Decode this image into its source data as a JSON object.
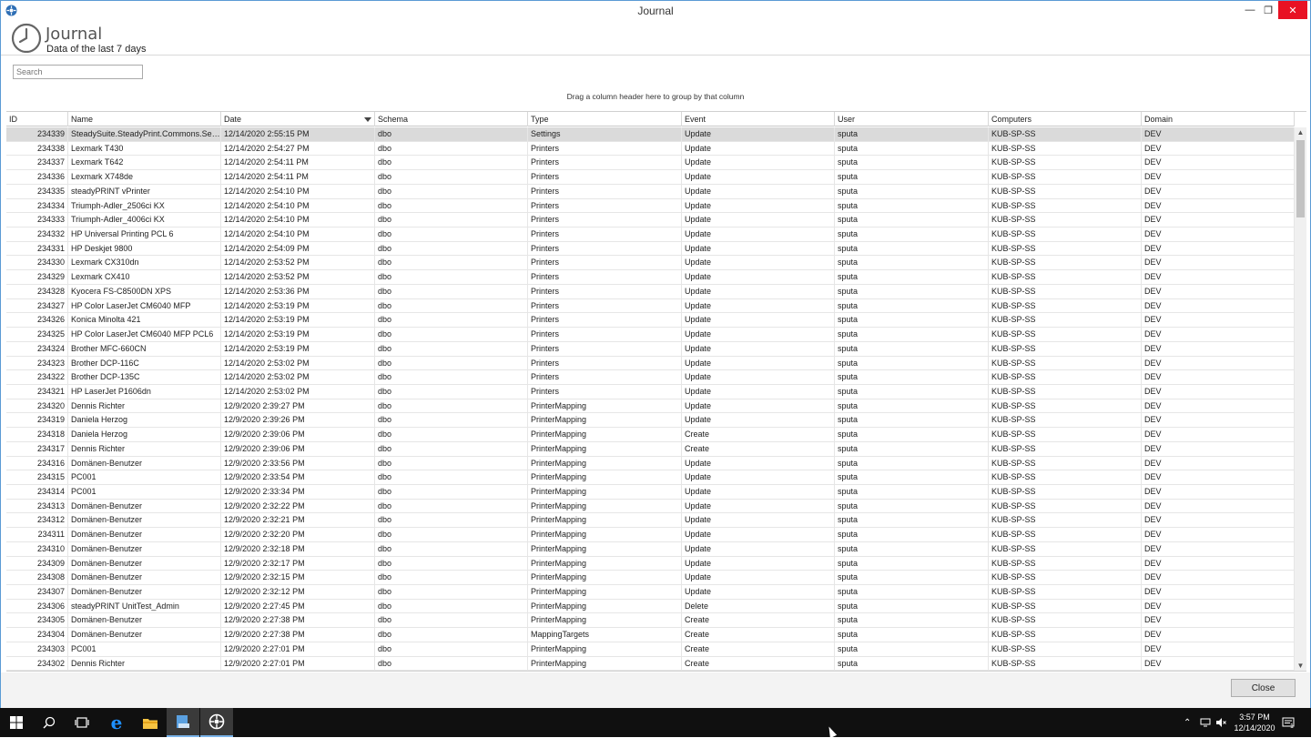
{
  "window": {
    "title": "Journal"
  },
  "header": {
    "title": "Journal",
    "subtitle": "Data of the last 7 days"
  },
  "search": {
    "placeholder": "Search"
  },
  "group_hint": "Drag a column header here to group by that column",
  "columns": [
    "ID",
    "Name",
    "Date",
    "Schema",
    "Type",
    "Event",
    "User",
    "Computers",
    "Domain"
  ],
  "rows": [
    [
      "234339",
      "SteadySuite.SteadyPrint.Commons.Sett...",
      "12/14/2020 2:55:15 PM",
      "dbo",
      "Settings",
      "Update",
      "sputa",
      "KUB-SP-SS",
      "DEV"
    ],
    [
      "234338",
      "Lexmark T430",
      "12/14/2020 2:54:27 PM",
      "dbo",
      "Printers",
      "Update",
      "sputa",
      "KUB-SP-SS",
      "DEV"
    ],
    [
      "234337",
      "Lexmark T642",
      "12/14/2020 2:54:11 PM",
      "dbo",
      "Printers",
      "Update",
      "sputa",
      "KUB-SP-SS",
      "DEV"
    ],
    [
      "234336",
      "Lexmark X748de",
      "12/14/2020 2:54:11 PM",
      "dbo",
      "Printers",
      "Update",
      "sputa",
      "KUB-SP-SS",
      "DEV"
    ],
    [
      "234335",
      "steadyPRINT vPrinter",
      "12/14/2020 2:54:10 PM",
      "dbo",
      "Printers",
      "Update",
      "sputa",
      "KUB-SP-SS",
      "DEV"
    ],
    [
      "234334",
      "Triumph-Adler_2506ci KX",
      "12/14/2020 2:54:10 PM",
      "dbo",
      "Printers",
      "Update",
      "sputa",
      "KUB-SP-SS",
      "DEV"
    ],
    [
      "234333",
      "Triumph-Adler_4006ci KX",
      "12/14/2020 2:54:10 PM",
      "dbo",
      "Printers",
      "Update",
      "sputa",
      "KUB-SP-SS",
      "DEV"
    ],
    [
      "234332",
      "HP Universal Printing PCL 6",
      "12/14/2020 2:54:10 PM",
      "dbo",
      "Printers",
      "Update",
      "sputa",
      "KUB-SP-SS",
      "DEV"
    ],
    [
      "234331",
      "HP Deskjet 9800",
      "12/14/2020 2:54:09 PM",
      "dbo",
      "Printers",
      "Update",
      "sputa",
      "KUB-SP-SS",
      "DEV"
    ],
    [
      "234330",
      "Lexmark CX310dn",
      "12/14/2020 2:53:52 PM",
      "dbo",
      "Printers",
      "Update",
      "sputa",
      "KUB-SP-SS",
      "DEV"
    ],
    [
      "234329",
      "Lexmark CX410",
      "12/14/2020 2:53:52 PM",
      "dbo",
      "Printers",
      "Update",
      "sputa",
      "KUB-SP-SS",
      "DEV"
    ],
    [
      "234328",
      "Kyocera FS-C8500DN XPS",
      "12/14/2020 2:53:36 PM",
      "dbo",
      "Printers",
      "Update",
      "sputa",
      "KUB-SP-SS",
      "DEV"
    ],
    [
      "234327",
      "HP Color LaserJet CM6040 MFP",
      "12/14/2020 2:53:19 PM",
      "dbo",
      "Printers",
      "Update",
      "sputa",
      "KUB-SP-SS",
      "DEV"
    ],
    [
      "234326",
      "Konica Minolta 421",
      "12/14/2020 2:53:19 PM",
      "dbo",
      "Printers",
      "Update",
      "sputa",
      "KUB-SP-SS",
      "DEV"
    ],
    [
      "234325",
      "HP Color LaserJet CM6040 MFP PCL6",
      "12/14/2020 2:53:19 PM",
      "dbo",
      "Printers",
      "Update",
      "sputa",
      "KUB-SP-SS",
      "DEV"
    ],
    [
      "234324",
      "Brother MFC-660CN",
      "12/14/2020 2:53:19 PM",
      "dbo",
      "Printers",
      "Update",
      "sputa",
      "KUB-SP-SS",
      "DEV"
    ],
    [
      "234323",
      "Brother DCP-116C",
      "12/14/2020 2:53:02 PM",
      "dbo",
      "Printers",
      "Update",
      "sputa",
      "KUB-SP-SS",
      "DEV"
    ],
    [
      "234322",
      "Brother DCP-135C",
      "12/14/2020 2:53:02 PM",
      "dbo",
      "Printers",
      "Update",
      "sputa",
      "KUB-SP-SS",
      "DEV"
    ],
    [
      "234321",
      "HP LaserJet P1606dn",
      "12/14/2020 2:53:02 PM",
      "dbo",
      "Printers",
      "Update",
      "sputa",
      "KUB-SP-SS",
      "DEV"
    ],
    [
      "234320",
      "Dennis Richter",
      "12/9/2020 2:39:27 PM",
      "dbo",
      "PrinterMapping",
      "Update",
      "sputa",
      "KUB-SP-SS",
      "DEV"
    ],
    [
      "234319",
      "Daniela Herzog",
      "12/9/2020 2:39:26 PM",
      "dbo",
      "PrinterMapping",
      "Update",
      "sputa",
      "KUB-SP-SS",
      "DEV"
    ],
    [
      "234318",
      "Daniela Herzog",
      "12/9/2020 2:39:06 PM",
      "dbo",
      "PrinterMapping",
      "Create",
      "sputa",
      "KUB-SP-SS",
      "DEV"
    ],
    [
      "234317",
      "Dennis Richter",
      "12/9/2020 2:39:06 PM",
      "dbo",
      "PrinterMapping",
      "Create",
      "sputa",
      "KUB-SP-SS",
      "DEV"
    ],
    [
      "234316",
      "Domänen-Benutzer",
      "12/9/2020 2:33:56 PM",
      "dbo",
      "PrinterMapping",
      "Update",
      "sputa",
      "KUB-SP-SS",
      "DEV"
    ],
    [
      "234315",
      "PC001",
      "12/9/2020 2:33:54 PM",
      "dbo",
      "PrinterMapping",
      "Update",
      "sputa",
      "KUB-SP-SS",
      "DEV"
    ],
    [
      "234314",
      "PC001",
      "12/9/2020 2:33:34 PM",
      "dbo",
      "PrinterMapping",
      "Update",
      "sputa",
      "KUB-SP-SS",
      "DEV"
    ],
    [
      "234313",
      "Domänen-Benutzer",
      "12/9/2020 2:32:22 PM",
      "dbo",
      "PrinterMapping",
      "Update",
      "sputa",
      "KUB-SP-SS",
      "DEV"
    ],
    [
      "234312",
      "Domänen-Benutzer",
      "12/9/2020 2:32:21 PM",
      "dbo",
      "PrinterMapping",
      "Update",
      "sputa",
      "KUB-SP-SS",
      "DEV"
    ],
    [
      "234311",
      "Domänen-Benutzer",
      "12/9/2020 2:32:20 PM",
      "dbo",
      "PrinterMapping",
      "Update",
      "sputa",
      "KUB-SP-SS",
      "DEV"
    ],
    [
      "234310",
      "Domänen-Benutzer",
      "12/9/2020 2:32:18 PM",
      "dbo",
      "PrinterMapping",
      "Update",
      "sputa",
      "KUB-SP-SS",
      "DEV"
    ],
    [
      "234309",
      "Domänen-Benutzer",
      "12/9/2020 2:32:17 PM",
      "dbo",
      "PrinterMapping",
      "Update",
      "sputa",
      "KUB-SP-SS",
      "DEV"
    ],
    [
      "234308",
      "Domänen-Benutzer",
      "12/9/2020 2:32:15 PM",
      "dbo",
      "PrinterMapping",
      "Update",
      "sputa",
      "KUB-SP-SS",
      "DEV"
    ],
    [
      "234307",
      "Domänen-Benutzer",
      "12/9/2020 2:32:12 PM",
      "dbo",
      "PrinterMapping",
      "Update",
      "sputa",
      "KUB-SP-SS",
      "DEV"
    ],
    [
      "234306",
      "steadyPRINT UnitTest_Admin",
      "12/9/2020 2:27:45 PM",
      "dbo",
      "PrinterMapping",
      "Delete",
      "sputa",
      "KUB-SP-SS",
      "DEV"
    ],
    [
      "234305",
      "Domänen-Benutzer",
      "12/9/2020 2:27:38 PM",
      "dbo",
      "PrinterMapping",
      "Create",
      "sputa",
      "KUB-SP-SS",
      "DEV"
    ],
    [
      "234304",
      "Domänen-Benutzer",
      "12/9/2020 2:27:38 PM",
      "dbo",
      "MappingTargets",
      "Create",
      "sputa",
      "KUB-SP-SS",
      "DEV"
    ],
    [
      "234303",
      "PC001",
      "12/9/2020 2:27:01 PM",
      "dbo",
      "PrinterMapping",
      "Create",
      "sputa",
      "KUB-SP-SS",
      "DEV"
    ],
    [
      "234302",
      "Dennis Richter",
      "12/9/2020 2:27:01 PM",
      "dbo",
      "PrinterMapping",
      "Create",
      "sputa",
      "KUB-SP-SS",
      "DEV"
    ]
  ],
  "selected_row": 0,
  "sort": {
    "column": "Date",
    "direction": "descending"
  },
  "buttons": {
    "close": "Close"
  },
  "taskbar": {
    "items": [
      "start-icon",
      "search-icon",
      "task-view-icon",
      "edge-icon",
      "file-explorer-icon",
      "app-icon",
      "steadyprint-icon"
    ],
    "time": "3:57 PM",
    "date": "12/14/2020",
    "notification_count": "1"
  },
  "colors": {
    "accent": "#5b9bd5",
    "close_button": "#e81123",
    "selected_row": "#dadada",
    "taskbar": "#101010"
  }
}
